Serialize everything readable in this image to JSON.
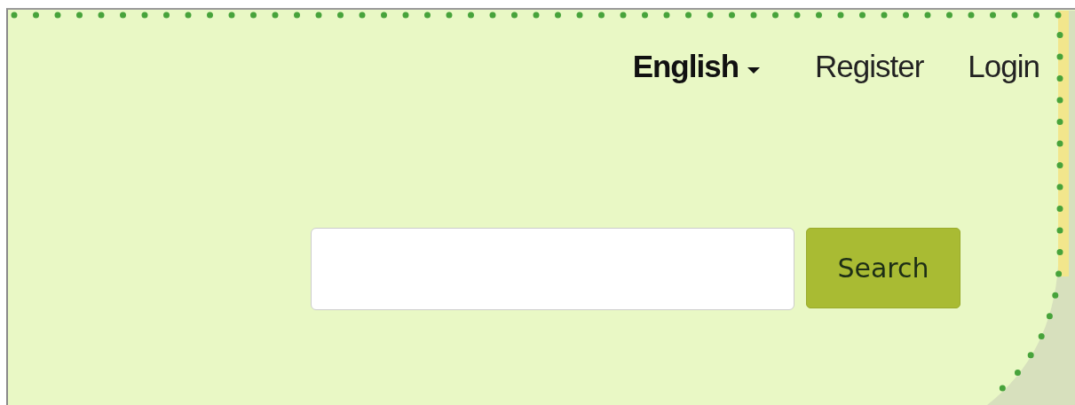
{
  "language_menu": {
    "label": "English"
  },
  "nav_links": [
    "Register",
    "Login"
  ],
  "search": {
    "button": "Search"
  }
}
